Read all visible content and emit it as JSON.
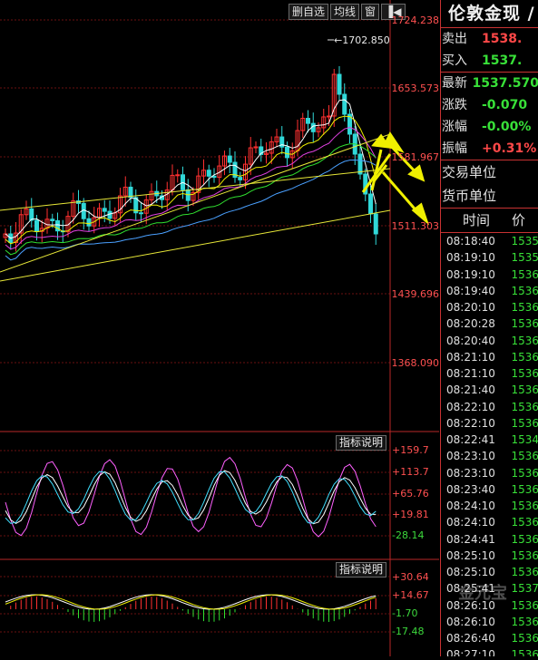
{
  "toolbar": {
    "delete_label": "删自选",
    "kline_label": "均线",
    "window_label": "窗",
    "pin_label": "▐◀"
  },
  "price_axis": [
    "1724.238",
    "1653.573",
    "1581.967",
    "1511.303",
    "1439.696",
    "1368.090"
  ],
  "high_marker": "←1702.850",
  "panels": {
    "macd_button": "指标说明",
    "macd_axis": [
      "+159.7",
      "+113.7",
      "+65.76",
      "+19.81",
      "-28.14"
    ],
    "vol_button": "指标说明",
    "vol_axis": [
      "+30.64",
      "+14.67",
      "-1.70",
      "-17.48"
    ]
  },
  "side": {
    "title": "伦敦金现 /",
    "sell_label": "卖出",
    "sell_value": "1538.",
    "buy_label": "买入",
    "buy_value": "1537.",
    "last_label": "最新",
    "last_value": "1537.570",
    "change_label": "涨跌",
    "change_value": "-0.070",
    "pct_label": "涨幅",
    "pct_value": "-0.00%",
    "amp_label": "振幅",
    "amp_value": "+0.31%",
    "unit_label": "交易单位",
    "currency_label": "货币单位",
    "tick_time_header": "时间",
    "tick_price_header": "价"
  },
  "ticks": [
    {
      "time": "08:18:40",
      "price": "1535"
    },
    {
      "time": "08:19:10",
      "price": "1535"
    },
    {
      "time": "08:19:10",
      "price": "1536"
    },
    {
      "time": "08:19:40",
      "price": "1536"
    },
    {
      "time": "08:20:10",
      "price": "1536"
    },
    {
      "time": "08:20:28",
      "price": "1536"
    },
    {
      "time": "08:20:40",
      "price": "1536"
    },
    {
      "time": "08:21:10",
      "price": "1536"
    },
    {
      "time": "08:21:10",
      "price": "1536"
    },
    {
      "time": "08:21:40",
      "price": "1536"
    },
    {
      "time": "08:22:10",
      "price": "1536"
    },
    {
      "time": "08:22:10",
      "price": "1536"
    },
    {
      "time": "08:22:41",
      "price": "1534"
    },
    {
      "time": "08:23:10",
      "price": "1536"
    },
    {
      "time": "08:23:10",
      "price": "1536"
    },
    {
      "time": "08:23:40",
      "price": "1536"
    },
    {
      "time": "08:24:10",
      "price": "1536"
    },
    {
      "time": "08:24:10",
      "price": "1536"
    },
    {
      "time": "08:24:41",
      "price": "1536"
    },
    {
      "time": "08:25:10",
      "price": "1536"
    },
    {
      "time": "08:25:10",
      "price": "1536"
    },
    {
      "time": "08:25:41",
      "price": "1537"
    },
    {
      "time": "08:26:10",
      "price": "1536"
    },
    {
      "time": "08:26:10",
      "price": "1536"
    },
    {
      "time": "08:26:40",
      "price": "1536"
    },
    {
      "time": "08:27:10",
      "price": "1536"
    }
  ],
  "watermark": "金元宝"
}
